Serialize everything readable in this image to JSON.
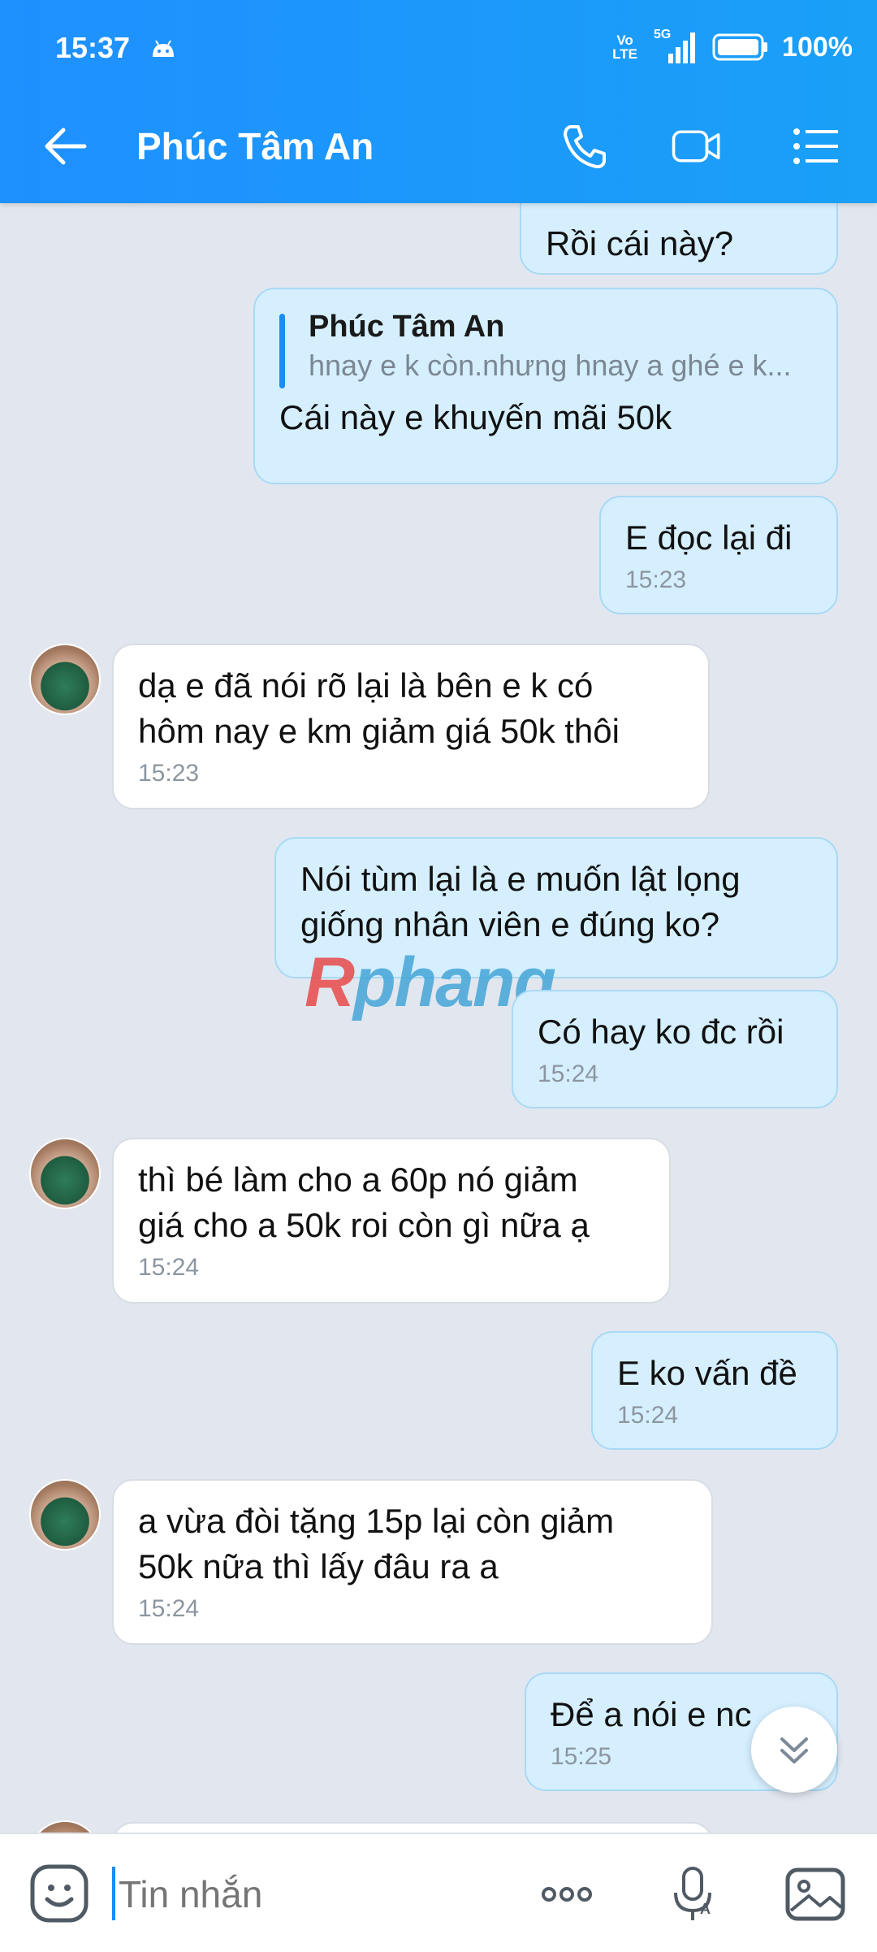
{
  "status_bar": {
    "time": "15:37",
    "volte_line1": "Vo",
    "volte_line2": "LTE",
    "network": "5G",
    "battery": "100%"
  },
  "header": {
    "title": "Phúc Tâm An"
  },
  "messages": [
    {
      "text": "Rồi cái này?",
      "direction": "out"
    },
    {
      "quote_name": "Phúc Tâm An",
      "quote_text": "hnay e k còn.nhưng hnay a ghé e k...",
      "text": "Cái này e khuyến mãi 50k",
      "direction": "out"
    },
    {
      "text": "E đọc lại đi",
      "time": "15:23",
      "direction": "out"
    },
    {
      "line1": "dạ e đã nói rõ lại là bên e k có",
      "line2": "hôm nay e km giảm giá 50k thôi",
      "time": "15:23",
      "direction": "in"
    },
    {
      "line1": "Nói tùm lại là e muốn lật lọng",
      "line2": "giống nhân viên e đúng ko?",
      "direction": "out"
    },
    {
      "text": "Có hay ko đc rồi",
      "time": "15:24",
      "direction": "out"
    },
    {
      "line1": "thì bé làm cho a 60p nó giảm",
      "line2": "giá cho a 50k roi còn gì nữa ạ",
      "time": "15:24",
      "direction": "in"
    },
    {
      "text": "E ko vấn đề",
      "time": "15:24",
      "direction": "out"
    },
    {
      "line1": "a vừa đòi tặng 15p lại còn giảm",
      "line2": "50k nữa thì lấy đâu ra a",
      "time": "15:24",
      "direction": "in"
    },
    {
      "text": "Để a nói e nc",
      "time": "15:25",
      "direction": "out"
    }
  ],
  "watermark": {
    "part1": "R",
    "part2": "phang"
  },
  "input": {
    "placeholder": "Tin nhắn"
  },
  "colors": {
    "accent": "#1b8cf2",
    "outgoing_bubble": "#d5efff",
    "incoming_bubble": "#ffffff",
    "background": "#e2e7ef"
  }
}
